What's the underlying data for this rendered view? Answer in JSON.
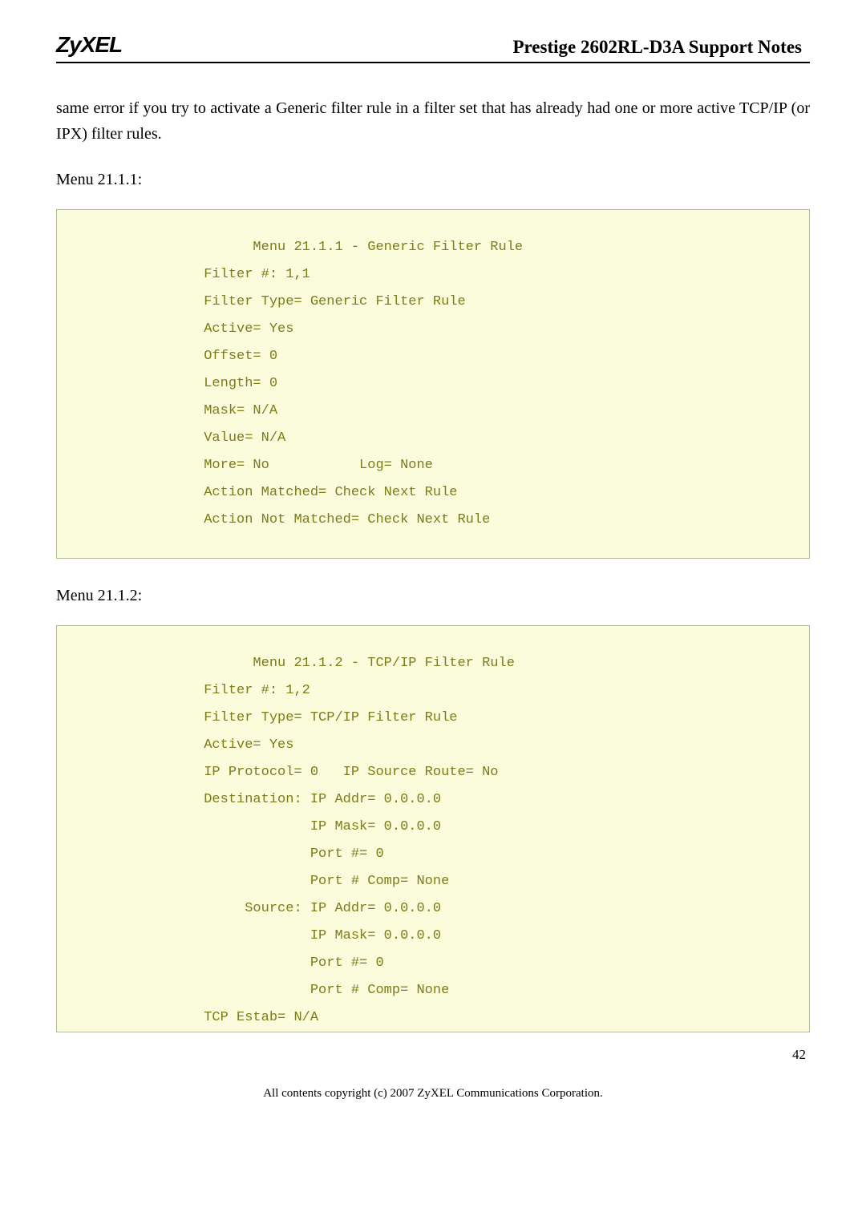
{
  "header": {
    "logo": "ZyXEL",
    "title": "Prestige 2602RL-D3A Support Notes"
  },
  "body": {
    "paragraph": "same error if you try to activate a Generic filter rule in a filter set that has already had one or more active TCP/IP (or IPX) filter rules.",
    "menu_label_1": "Menu 21.1.1:",
    "code_block_1": "                      Menu 21.1.1 - Generic Filter Rule\n                Filter #: 1,1\n                Filter Type= Generic Filter Rule\n                Active= Yes\n                Offset= 0\n                Length= 0\n                Mask= N/A\n                Value= N/A\n                More= No           Log= None\n                Action Matched= Check Next Rule\n                Action Not Matched= Check Next Rule\n",
    "menu_label_2": "Menu 21.1.2:",
    "code_block_2": "                      Menu 21.1.2 - TCP/IP Filter Rule\n                Filter #: 1,2\n                Filter Type= TCP/IP Filter Rule\n                Active= Yes\n                IP Protocol= 0   IP Source Route= No\n                Destination: IP Addr= 0.0.0.0\n                             IP Mask= 0.0.0.0\n                             Port #= 0\n                             Port # Comp= None\n                     Source: IP Addr= 0.0.0.0\n                             IP Mask= 0.0.0.0\n                             Port #= 0\n                             Port # Comp= None\n                TCP Estab= N/A"
  },
  "footer": {
    "copyright": "All contents copyright (c) 2007 ZyXEL Communications Corporation.",
    "page_num": "42"
  }
}
